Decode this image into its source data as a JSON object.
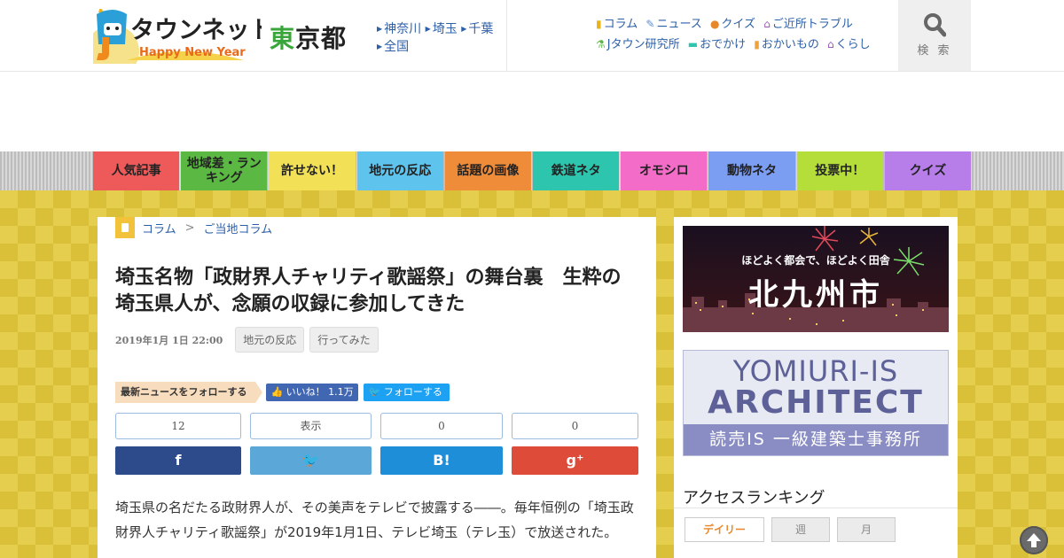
{
  "logo": {
    "brand": "タウンネット",
    "sub": "Happy New Year"
  },
  "header": {
    "prefecture_hl": "東",
    "prefecture_rest": "京都",
    "area_links": [
      "神奈川",
      "埼玉",
      "千葉",
      "全国"
    ],
    "category_links_row1": [
      {
        "label": "コラム",
        "icon": "notepad-icon"
      },
      {
        "label": "ニュース",
        "icon": "pencil-icon"
      },
      {
        "label": "クイズ",
        "icon": "quiz-icon"
      },
      {
        "label": "ご近所トラブル",
        "icon": "house-icon"
      }
    ],
    "category_links_row2": [
      {
        "label": "Jタウン研究所",
        "icon": "flask-icon"
      },
      {
        "label": "おでかけ",
        "icon": "car-icon"
      },
      {
        "label": "おかいもの",
        "icon": "bag-icon"
      },
      {
        "label": "くらし",
        "icon": "house-icon"
      }
    ],
    "search_label": "検 索"
  },
  "nav": [
    {
      "label": "人気記事",
      "color": "#ee5a5a"
    },
    {
      "label": "地域差・ランキング",
      "color": "#5bb842"
    },
    {
      "label": "許せない！",
      "color": "#f2e157"
    },
    {
      "label": "地元の反応",
      "color": "#5ec4ee"
    },
    {
      "label": "話題の画像",
      "color": "#ef8c3a"
    },
    {
      "label": "鉄道ネタ",
      "color": "#2ec5ae"
    },
    {
      "label": "オモシロ",
      "color": "#f26cc8"
    },
    {
      "label": "動物ネタ",
      "color": "#7b9ef2"
    },
    {
      "label": "投票中！",
      "color": "#b6de3a"
    },
    {
      "label": "クイズ",
      "color": "#b77de8"
    }
  ],
  "breadcrumb": {
    "level1": "コラム",
    "separator": ">",
    "level2": "ご当地コラム"
  },
  "article": {
    "title": "埼玉名物「政財界人チャリティ歌謡祭」の舞台裏　生粋の埼玉県人が、念願の収録に参加してきた",
    "date": "2019年1月 1日 22:00",
    "tags": [
      "地元の反応",
      "行ってみた"
    ],
    "follow_label": "最新ニュースをフォローする",
    "fb_like": "いいね！ 1.1万",
    "tw_follow": "フォローする",
    "share": [
      {
        "count": "12",
        "service": "facebook",
        "glyph": "f",
        "color": "#2d4a8a"
      },
      {
        "count": "表示",
        "service": "twitter",
        "glyph": "🐦",
        "color": "#5aa7d8"
      },
      {
        "count": "0",
        "service": "hatena",
        "glyph": "B!",
        "color": "#1f8ed8"
      },
      {
        "count": "0",
        "service": "googleplus",
        "glyph": "g⁺",
        "color": "#de4b39"
      }
    ],
    "body": "埼玉県の名だたる政財界人が、その美声をテレビで披露する――。毎年恒例の「埼玉政財界人チャリティ歌謡祭」が2019年1月1日、テレビ埼玉（テレ玉）で放送された。"
  },
  "sidebar": {
    "banner1": {
      "top_text": "ほどよく都会で、ほどよく田舎",
      "city": "北九州市"
    },
    "banner2": {
      "line1": "YOMIURI-IS",
      "line2": "ARCHITECT",
      "line3": "読売IS 一級建築士事務所"
    },
    "ranking_title": "アクセスランキング",
    "tabs": [
      "デイリー",
      "週",
      "月"
    ]
  }
}
